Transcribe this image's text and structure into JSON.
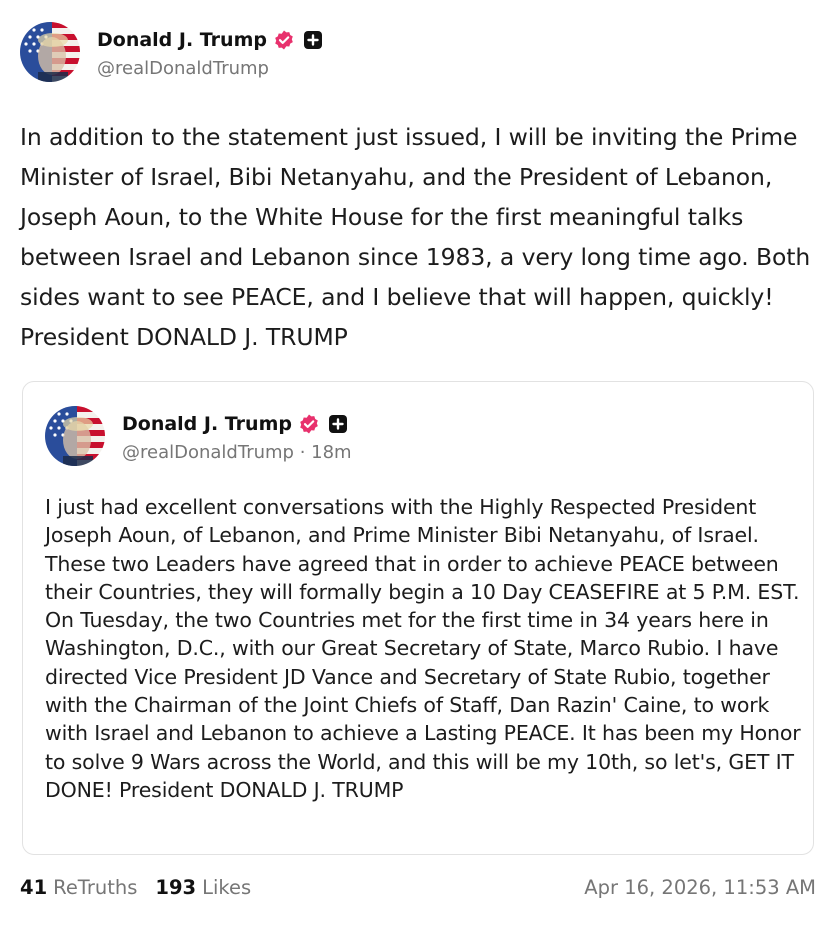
{
  "author": {
    "display_name": "Donald J. Trump",
    "handle": "@realDonaldTrump",
    "verified_icon": "verified-badge-icon",
    "plus_icon": "plus-badge-icon",
    "verified_color": "#e8316d"
  },
  "post": {
    "text": "In addition to the statement just issued, I will be inviting the Prime Minister of Israel, Bibi Netanyahu, and the President of Lebanon, Joseph Aoun, to the White House for the first meaningful talks between Israel and Lebanon since 1983, a very long time ago. Both sides want to see PEACE, and I believe that will happen, quickly! President DONALD J. TRUMP"
  },
  "quoted_post": {
    "display_name": "Donald J. Trump",
    "handle_meta": "@realDonaldTrump · 18m",
    "text": "I just had excellent conversations with the Highly Respected President Joseph Aoun, of Lebanon, and Prime Minister Bibi Netanyahu, of Israel. These two Leaders have agreed that in order to achieve PEACE between their Countries, they will formally begin a 10 Day CEASEFIRE at 5 P.M. EST. On Tuesday, the two Countries met for the first time in 34 years here in Washington, D.C., with our Great Secretary of State, Marco Rubio. I have directed Vice President JD Vance and Secretary of State Rubio, together with the Chairman of the Joint Chiefs of Staff, Dan Razin' Caine, to work with Israel and Lebanon to achieve a Lasting PEACE. It has been my Honor to solve 9 Wars across the World, and this will be my 10th, so let's, GET IT DONE! President DONALD J. TRUMP"
  },
  "footer": {
    "retruths_count": "41",
    "retruths_label": "ReTruths",
    "likes_count": "193",
    "likes_label": "Likes",
    "timestamp": "Apr 16, 2026, 11:53 AM"
  }
}
